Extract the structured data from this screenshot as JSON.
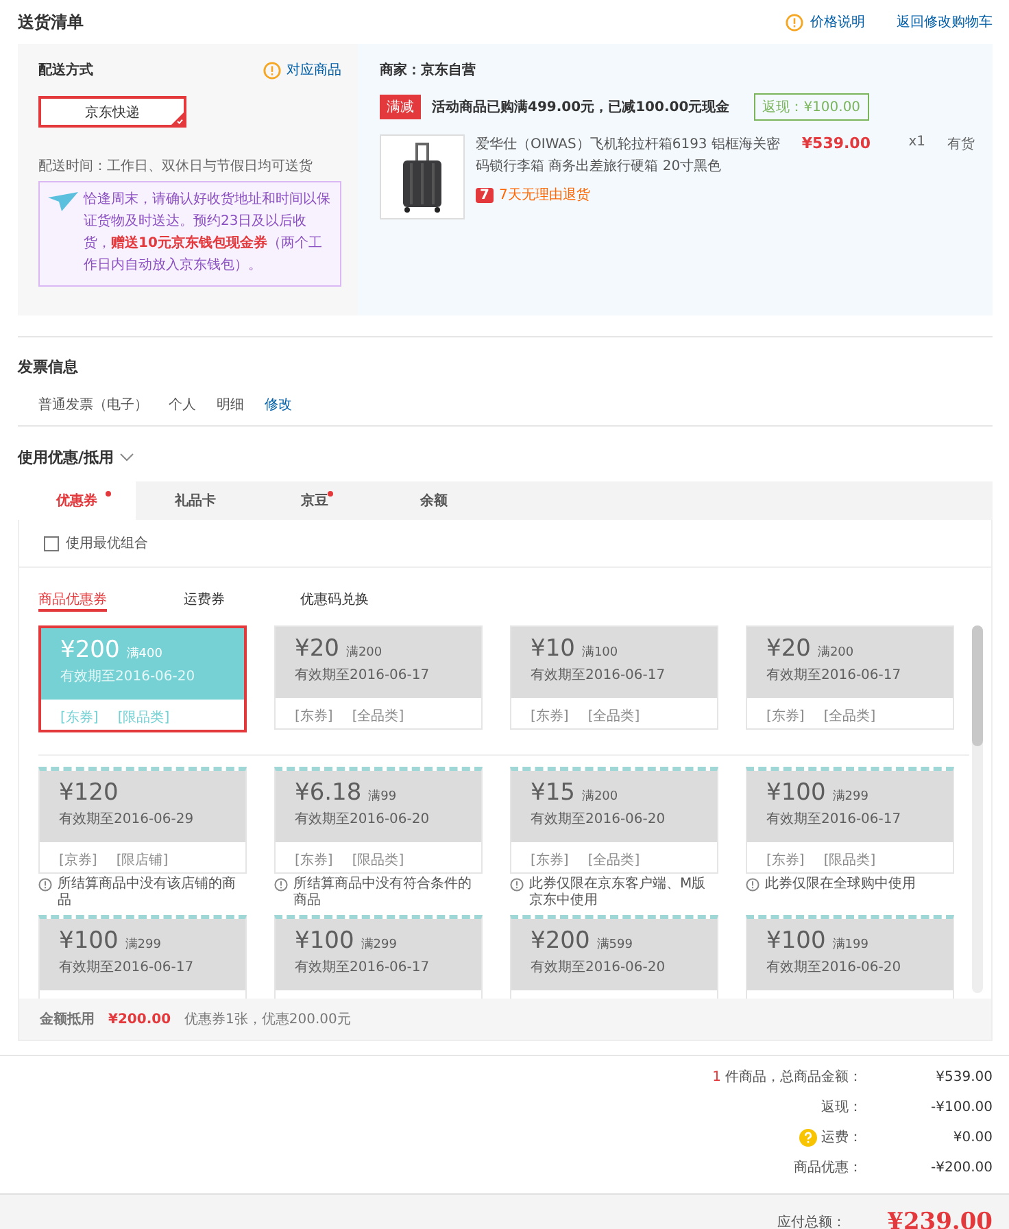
{
  "page_title": "送货清单",
  "header_links": [
    {
      "kind": "info",
      "label": "价格说明"
    },
    {
      "kind": "plain",
      "label": "返回修改购物车"
    }
  ],
  "shipping": {
    "title": "配送方式",
    "link": "对应商品",
    "options": [
      {
        "label": "京东快递",
        "selected": true
      }
    ],
    "time": "配送时间：工作日、双休日与节假日均可送货",
    "notice": "恰逢周末，请确认好收货地址和时间以保证货物及时送达。预约23日及以后收货，**赠送10元京东钱包现金券**（两个工作日内自动放入京东钱包）。"
  },
  "seller": {
    "name": "商家：京东自营",
    "promo_tag": "满减",
    "promo_text": "活动商品已购满499.00元，已减100.00元现金",
    "cashback": "返现：¥100.00",
    "items": [
      {
        "title": "爱华仕（OIWAS）飞机轮拉杆箱6193 铝框海关密码锁行李箱 商务出差旅行硬箱 20寸黑色",
        "return_badge": "7",
        "return_text": "7天无理由退货",
        "price": "¥539.00",
        "qty": "x1",
        "stock": "有货"
      }
    ]
  },
  "invoice": {
    "title": "发票信息",
    "fields": [
      "普通发票（电子）",
      "个人",
      "明细"
    ],
    "edit": "修改"
  },
  "discounts": {
    "title": "使用优惠/抵用",
    "tabs": [
      {
        "label": "优惠券",
        "selected": true,
        "dot": true
      },
      {
        "label": "礼品卡",
        "selected": false,
        "dot": false
      },
      {
        "label": "京豆",
        "selected": false,
        "dot": true
      },
      {
        "label": "余额",
        "selected": false,
        "dot": false
      }
    ],
    "best_combo": {
      "label": "使用最优组合",
      "checked": false
    },
    "subtabs": [
      {
        "label": "商品优惠券",
        "selected": true
      },
      {
        "label": "运费券",
        "selected": false
      },
      {
        "label": "优惠码兑换",
        "selected": false
      }
    ],
    "groups": [
      {
        "kind": "usable",
        "coupons": [
          {
            "amount": "¥200",
            "condition": "满400",
            "expiry": "有效期至2016-06-20",
            "tags": [
              "[东券]",
              "[限品类]"
            ],
            "selected": true
          },
          {
            "amount": "¥20",
            "condition": "满200",
            "expiry": "有效期至2016-06-17",
            "tags": [
              "[东券]",
              "[全品类]"
            ],
            "selected": false
          },
          {
            "amount": "¥10",
            "condition": "满100",
            "expiry": "有效期至2016-06-17",
            "tags": [
              "[东券]",
              "[全品类]"
            ],
            "selected": false
          },
          {
            "amount": "¥20",
            "condition": "满200",
            "expiry": "有效期至2016-06-17",
            "tags": [
              "[东券]",
              "[全品类]"
            ],
            "selected": false
          }
        ]
      },
      {
        "kind": "unusable",
        "coupons": [
          {
            "amount": "¥120",
            "expiry": "有效期至2016-06-29",
            "tags": [
              "[京券]",
              "[限店铺]"
            ],
            "selected": false,
            "notice": "所结算商品中没有该店铺的商品"
          },
          {
            "amount": "¥6.18",
            "condition": "满99",
            "expiry": "有效期至2016-06-20",
            "tags": [
              "[东券]",
              "[限品类]"
            ],
            "selected": false,
            "notice": "所结算商品中没有符合条件的商品"
          },
          {
            "amount": "¥15",
            "condition": "满200",
            "expiry": "有效期至2016-06-20",
            "tags": [
              "[东券]",
              "[全品类]"
            ],
            "selected": false,
            "notice": "此券仅限在京东客户端、M版京东中使用"
          },
          {
            "amount": "¥100",
            "condition": "满299",
            "expiry": "有效期至2016-06-17",
            "tags": [
              "[东券]",
              "[限品类]"
            ],
            "selected": false,
            "notice": "此券仅限在全球购中使用"
          },
          {
            "amount": "¥100",
            "condition": "满299",
            "expiry": "有效期至2016-06-17",
            "selected": false
          },
          {
            "amount": "¥100",
            "condition": "满299",
            "expiry": "有效期至2016-06-17",
            "selected": false
          },
          {
            "amount": "¥200",
            "condition": "满599",
            "expiry": "有效期至2016-06-20",
            "selected": false
          },
          {
            "amount": "¥100",
            "condition": "满199",
            "expiry": "有效期至2016-06-20",
            "selected": false
          }
        ]
      }
    ],
    "summary": {
      "label": "金额抵用",
      "amount": "¥200.00",
      "detail": "优惠券1张，优惠200.00元"
    }
  },
  "totals": [
    {
      "kind": "count",
      "count": "1",
      "label": "件商品，总商品金额：",
      "value": "¥539.00"
    },
    {
      "kind": "plain",
      "label": "返现：",
      "value": "-¥100.00"
    },
    {
      "kind": "help",
      "label": "运费：",
      "value": "¥0.00"
    },
    {
      "kind": "plain",
      "label": "商品优惠：",
      "value": "-¥200.00"
    }
  ],
  "payable": {
    "label": "应付总额：",
    "value": "¥239.00"
  }
}
